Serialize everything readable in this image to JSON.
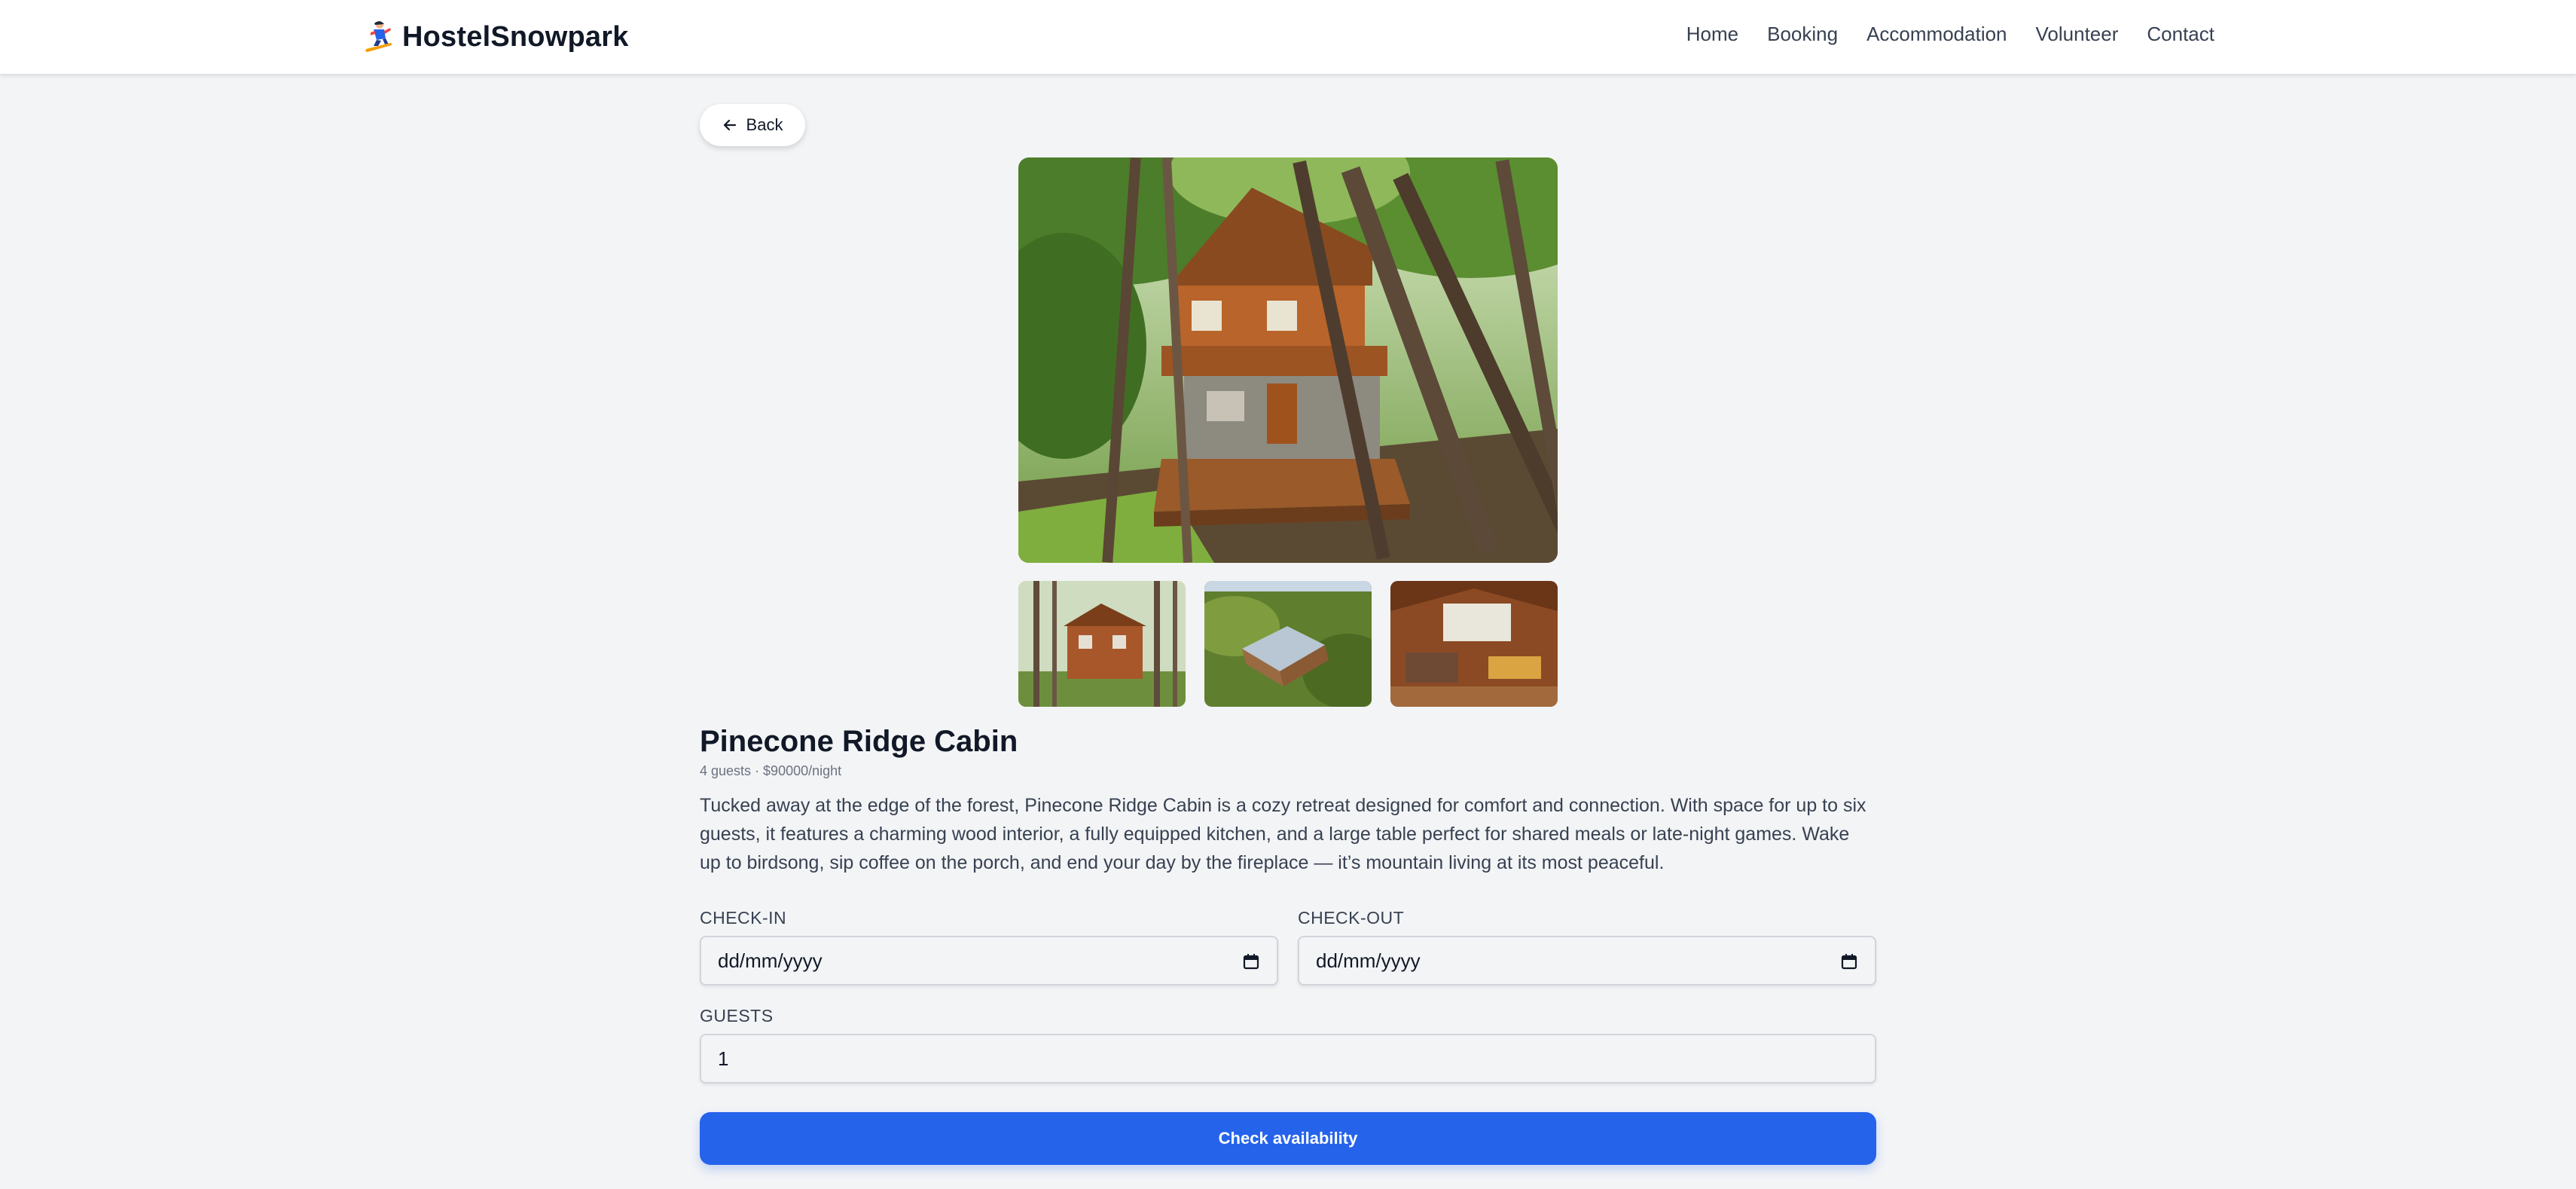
{
  "brand": {
    "name": "HostelSnowpark",
    "icon": "snowboarder-icon"
  },
  "nav": {
    "items": [
      {
        "label": "Home"
      },
      {
        "label": "Booking"
      },
      {
        "label": "Accommodation"
      },
      {
        "label": "Volunteer"
      },
      {
        "label": "Contact"
      }
    ]
  },
  "back": {
    "label": "Back",
    "icon": "arrow-left-icon"
  },
  "gallery": {
    "main": "cabin-in-forest-photo",
    "thumbnails": [
      "cabin-exterior-thumbnail",
      "cabin-roof-aerial-thumbnail",
      "cabin-interior-thumbnail"
    ]
  },
  "listing": {
    "title": "Pinecone Ridge Cabin",
    "meta": "4 guests · $90000/night",
    "description": "Tucked away at the edge of the forest, Pinecone Ridge Cabin is a cozy retreat designed for comfort and connection. With space for up to six guests, it features a charming wood interior, a fully equipped kitchen, and a large table perfect for shared meals or late-night games. Wake up to birdsong, sip coffee on the porch, and end your day by the fireplace — it’s mountain living at its most peaceful."
  },
  "form": {
    "checkin": {
      "label": "CHECK-IN",
      "value": "dd/mm/yyyy",
      "icon": "calendar-icon"
    },
    "checkout": {
      "label": "CHECK-OUT",
      "value": "dd/mm/yyyy",
      "icon": "calendar-icon"
    },
    "guests": {
      "label": "GUESTS",
      "value": "1"
    },
    "submit_label": "Check availability"
  },
  "colors": {
    "primary": "#2563eb",
    "background": "#f3f4f6",
    "header": "#ffffff"
  }
}
